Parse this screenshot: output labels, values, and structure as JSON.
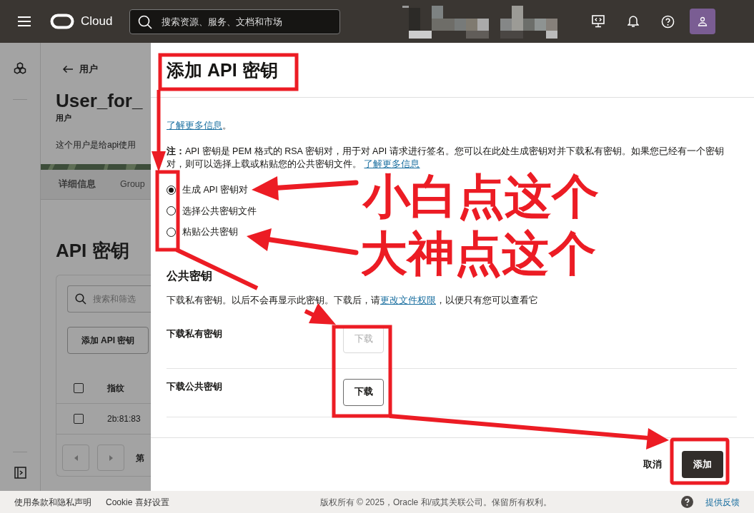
{
  "header": {
    "brand": "Cloud",
    "search_placeholder": "搜索资源、服务、文档和市场"
  },
  "page": {
    "back_link": "用户",
    "title": "User_for_",
    "subtitle": "用户",
    "description": "这个用户是给api使用",
    "tabs": [
      {
        "label": "详细信息",
        "selected": true
      },
      {
        "label": "Group",
        "selected": false
      }
    ],
    "section_title": "API 密钥",
    "filter_placeholder": "搜索和筛选",
    "add_button": "添加 API 密钥",
    "table": {
      "header_checked": false,
      "columns": [
        "指纹"
      ],
      "rows": [
        {
          "checked": false,
          "cells": [
            "2b:81:83"
          ]
        }
      ]
    },
    "pagination_text": "第"
  },
  "drawer": {
    "title": "添加 API 密钥",
    "learn_more": "了解更多信息",
    "learn_more_suffix": "。",
    "note": "**注：**API 密钥是 PEM 格式的 RSA 密钥对，用于对 API 请求进行签名。您可以在此处生成密钥对并下载私有密钥。如果您已经有一个密钥对，则可以选择上载或粘贴您的公共密钥文件。",
    "note_link": "了解更多信息",
    "options": [
      {
        "label": "生成 API 密钥对",
        "selected": true
      },
      {
        "label": "选择公共密钥文件",
        "selected": false
      },
      {
        "label": "粘贴公共密钥",
        "selected": false
      }
    ],
    "section_title": "公共密钥",
    "section_text": "下载私有密钥。以后不会再显示此密钥。下载后，请",
    "section_link": "更改文件权限",
    "section_text_end": "，以便只有您可以查看它",
    "downloads": [
      {
        "label": "下载私有密钥",
        "button": "下载",
        "disabled": true
      },
      {
        "label": "下载公共密钥",
        "button": "下载",
        "disabled": false
      }
    ],
    "cancel": "取消",
    "submit": "添加"
  },
  "footer": {
    "links": [
      "使用条款和隐私声明",
      "Cookie 喜好设置"
    ],
    "copyright": "版权所有 © 2025，Oracle 和/或其关联公司。保留所有权利。",
    "feedback": "提供反馈"
  },
  "annotations": [
    "小白点这个",
    "大神点这个"
  ]
}
